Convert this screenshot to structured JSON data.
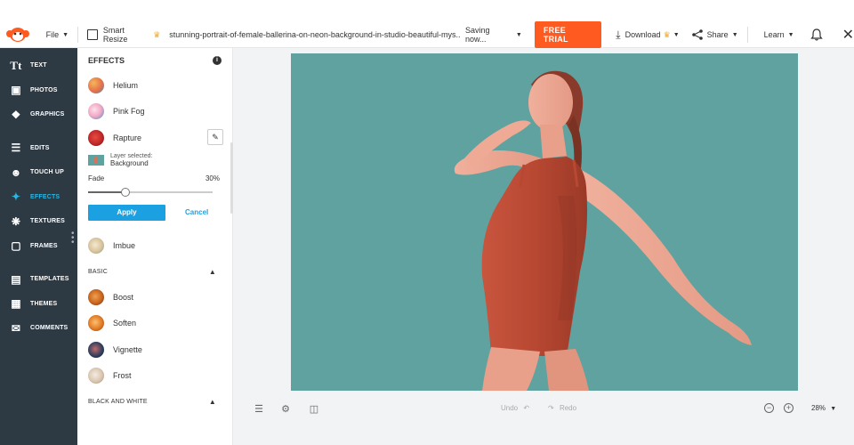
{
  "topbar": {
    "file_label": "File",
    "smart_resize_label": "Smart Resize",
    "filename": "stunning-portrait-of-female-ballerina-on-neon-background-in-studio-beautiful-mys...",
    "saving_label": "Saving now...",
    "trial_label": "FREE TRIAL",
    "download_label": "Download",
    "share_label": "Share",
    "learn_label": "Learn"
  },
  "nav": [
    {
      "label": "TEXT",
      "icon": "text-icon"
    },
    {
      "label": "PHOTOS",
      "icon": "photos-icon"
    },
    {
      "label": "GRAPHICS",
      "icon": "graphics-icon"
    },
    {
      "label": "EDITS",
      "icon": "sliders-icon"
    },
    {
      "label": "TOUCH UP",
      "icon": "face-icon"
    },
    {
      "label": "EFFECTS",
      "icon": "wand-icon"
    },
    {
      "label": "TEXTURES",
      "icon": "texture-icon"
    },
    {
      "label": "FRAMES",
      "icon": "frame-icon"
    },
    {
      "label": "TEMPLATES",
      "icon": "templates-icon"
    },
    {
      "label": "THEMES",
      "icon": "themes-icon"
    },
    {
      "label": "COMMENTS",
      "icon": "comment-icon"
    }
  ],
  "panel": {
    "title": "EFFECTS",
    "effects_top": [
      {
        "label": "Helium",
        "color": "#e8704a"
      },
      {
        "label": "Pink Fog",
        "color": "#f1a8c4"
      },
      {
        "label": "Rapture",
        "color": "#c0282a"
      }
    ],
    "layer_selected_label": "Layer selected:",
    "layer_name": "Background",
    "fade_label": "Fade",
    "fade_value": "30%",
    "fade_fraction": 0.3,
    "apply_label": "Apply",
    "cancel_label": "Cancel",
    "imbue_label": "Imbue",
    "section_basic": "BASIC",
    "basic_effects": [
      {
        "label": "Boost",
        "color": "#c8641e"
      },
      {
        "label": "Soften",
        "color": "#e07a24"
      },
      {
        "label": "Vignette",
        "color": "#2a3c5c"
      },
      {
        "label": "Frost",
        "color": "#d9c6b0"
      }
    ],
    "section_bw": "BLACK AND WHITE"
  },
  "bottombar": {
    "undo_label": "Undo",
    "redo_label": "Redo",
    "zoom_label": "28%"
  },
  "colors": {
    "nav_bg": "#2d3a44",
    "accent": "#1ba1e2",
    "active_nav": "#28b6e4",
    "trial_bg": "#ff5a1f",
    "photo_bg": "#5fa29f"
  }
}
